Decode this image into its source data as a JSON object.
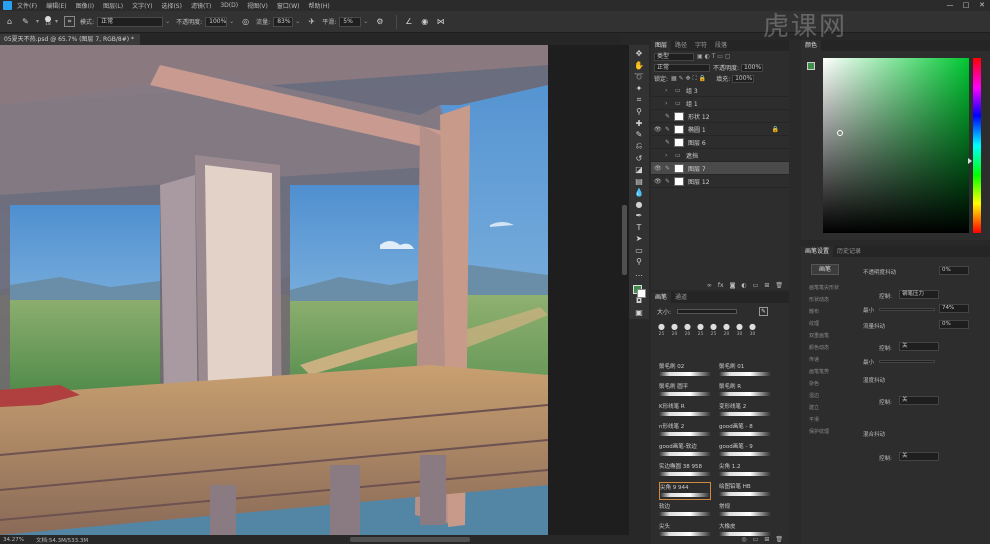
{
  "menubar": {
    "items": [
      "文件(F)",
      "编辑(E)",
      "图像(I)",
      "图层(L)",
      "文字(Y)",
      "选择(S)",
      "滤镜(T)",
      "3D(D)",
      "视图(V)",
      "窗口(W)",
      "帮助(H)"
    ],
    "window_controls": [
      "—",
      "□",
      "✕"
    ]
  },
  "options": {
    "brush_size": "18",
    "mode_label": "模式:",
    "mode_value": "正常",
    "opacity_label": "不透明度:",
    "opacity_value": "100%",
    "flow_label": "流量:",
    "flow_value": "83%",
    "smooth_label": "平滑:",
    "smooth_value": "5%"
  },
  "document": {
    "tab_title": "05夏天不热.psd @ 65.7% (图层 7, RGB/8#) *",
    "close": "×"
  },
  "status": {
    "zoom": "34.27%",
    "doc_info": "文档:54.3M/533.3M"
  },
  "layers_panel": {
    "tabs": [
      "图层",
      "路径",
      "字符",
      "段落"
    ],
    "kind_filter": "类型",
    "blend_mode": "正常",
    "opacity_label": "不透明度:",
    "opacity_value": "100%",
    "lock_label": "锁定:",
    "fill_label": "填充:",
    "fill_value": "100%",
    "layers": [
      {
        "name": "组 3",
        "type": "group"
      },
      {
        "name": "组 1",
        "type": "group"
      },
      {
        "name": "形状 12",
        "type": "shape"
      },
      {
        "name": "椭圆 1",
        "type": "brush",
        "visible": true,
        "locked": true
      },
      {
        "name": "图层 6",
        "type": "brush"
      },
      {
        "name": "遮挡",
        "type": "group"
      },
      {
        "name": "图层 7",
        "type": "brush",
        "visible": true,
        "selected": true
      },
      {
        "name": "图层 12",
        "type": "brush",
        "visible": true
      }
    ]
  },
  "brush_panel": {
    "tabs": [
      "画笔",
      "通道"
    ],
    "size_label": "大小:",
    "tips": [
      "25",
      "20",
      "20",
      "25",
      "25",
      "20",
      "30",
      "30"
    ],
    "presets": [
      {
        "name": "鬃毛刷 02"
      },
      {
        "name": "鬃毛刷 01"
      },
      {
        "name": "鬃毛刷 圆平"
      },
      {
        "name": "鬃毛刷 R"
      },
      {
        "name": "K形线笔 R"
      },
      {
        "name": "变形线笔 2"
      },
      {
        "name": "n形线笔 2"
      },
      {
        "name": "good画笔 - 8"
      },
      {
        "name": "good画笔-软边"
      },
      {
        "name": "good画笔 - 9"
      },
      {
        "name": "实边椭圆 38 958"
      },
      {
        "name": "尖角 1.2"
      },
      {
        "name": "尖角 9 944",
        "selected": true
      },
      {
        "name": "绘图铅笔 HB"
      },
      {
        "name": "软边"
      },
      {
        "name": "常规"
      },
      {
        "name": "尖头"
      },
      {
        "name": "大橡皮"
      }
    ]
  },
  "color_panel": {
    "title": "颜色",
    "accent": "#3f8f4a"
  },
  "brush_settings": {
    "tabs": [
      "画笔设置",
      "历史记录"
    ],
    "button_label": "画笔",
    "jitter_label": "不透明度抖动",
    "jitter_value": "0%",
    "control_label": "控制:",
    "control_value": "钢笔压力",
    "min_label": "最小",
    "min_value": "74%",
    "flow_jitter_label": "流量抖动",
    "flow_jitter_value": "0%",
    "control2_value": "关",
    "min2_label": "最小",
    "wet_jitter_label": "湿度抖动",
    "control3_value": "关",
    "mix_jitter_label": "混合抖动",
    "control4_value": "关",
    "options": [
      "画笔笔尖形状",
      "形状动态",
      "散布",
      "纹理",
      "双重画笔",
      "颜色动态",
      "传递",
      "画笔笔势",
      "杂色",
      "湿边",
      "建立",
      "平滑",
      "保护纹理"
    ]
  },
  "watermark": {
    "text": "虎课网"
  }
}
